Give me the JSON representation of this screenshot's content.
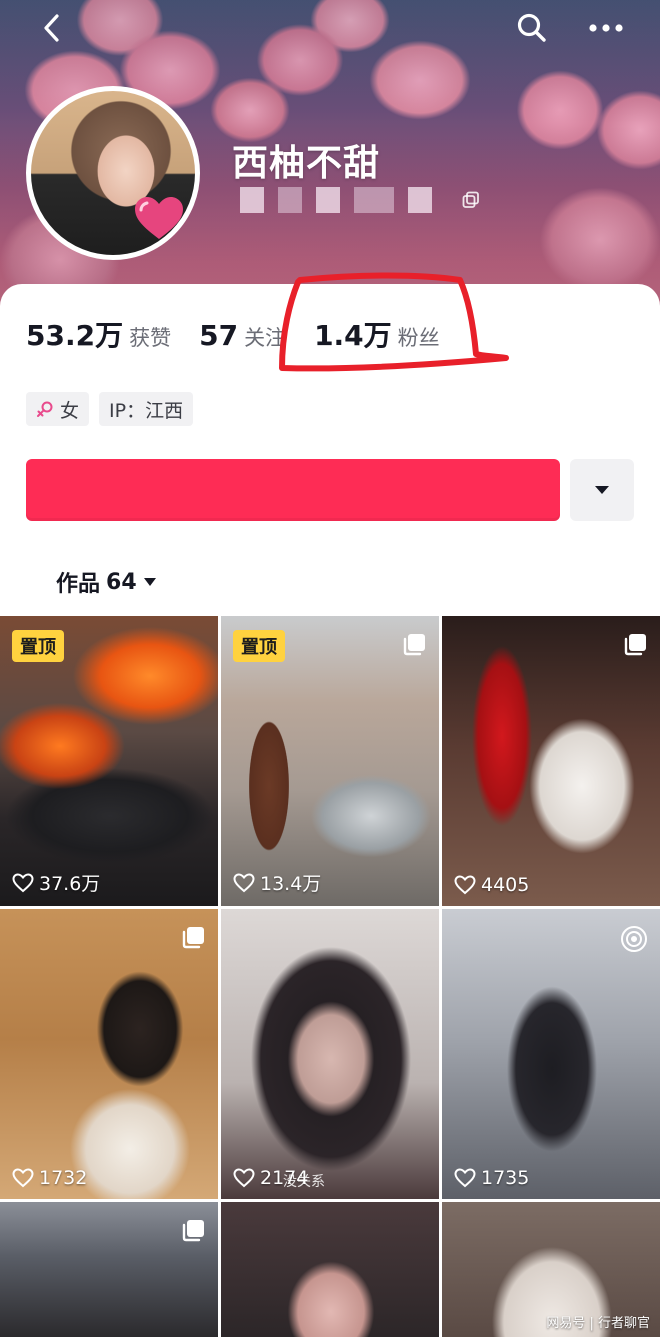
{
  "profile": {
    "nickname": "西柚不甜"
  },
  "stats": {
    "likes_num": "53.2万",
    "likes_label": "获赞",
    "following_num": "57",
    "following_label": "关注",
    "fans_num": "1.4万",
    "fans_label": "粉丝"
  },
  "tags": {
    "gender": "女",
    "ip": "IP：江西"
  },
  "tabs": {
    "works_label": "作品",
    "works_count": "64"
  },
  "grid": [
    {
      "badge": "置顶",
      "likes": "37.6万",
      "type": "video"
    },
    {
      "badge": "置顶",
      "likes": "13.4万",
      "type": "multi"
    },
    {
      "badge": "",
      "likes": "4405",
      "type": "multi"
    },
    {
      "badge": "",
      "likes": "1732",
      "type": "multi"
    },
    {
      "badge": "",
      "likes": "2174",
      "type": "video",
      "caption": "没关系"
    },
    {
      "badge": "",
      "likes": "1735",
      "type": "live"
    },
    {
      "badge": "",
      "likes": "",
      "type": "multi"
    },
    {
      "badge": "",
      "likes": "",
      "type": "video"
    },
    {
      "badge": "",
      "likes": "",
      "type": "video"
    }
  ],
  "watermark": "网易号 | 行者聊官",
  "colors": {
    "follow_button": "#fe2c55",
    "pin_badge": "#ffd23f",
    "annotation_circle": "#e8202a"
  },
  "icons": [
    "back-icon",
    "search-icon",
    "more-icon",
    "copy-icon",
    "female-icon",
    "caret-down-icon",
    "heart-icon",
    "multi-image-icon",
    "live-icon"
  ]
}
